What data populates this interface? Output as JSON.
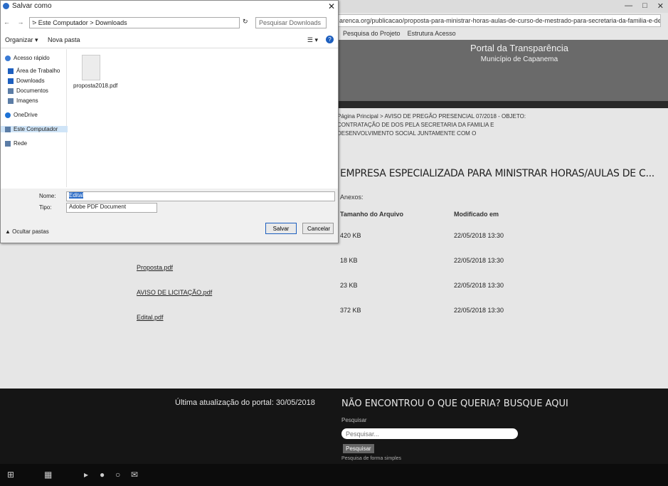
{
  "browser": {
    "controls": [
      "—",
      "□",
      "✕"
    ],
    "address": "arenca.org/publicacao/proposta-para-ministrar-horas-aulas-de-curso-de-mestrado-para-secretaria-da-familia-e-desenvolvimento-social-juntamente",
    "bookmarks": [
      "Pesquisa do Projeto",
      "Estrutura Acesso"
    ]
  },
  "site": {
    "title": "Portal da Transparência",
    "subtitle": "Município de Capanema",
    "breadcrumb": "Página Principal > AVISO DE PREGÃO PRESENCIAL 07/2018 - OBJETO: CONTRATAÇÃO DE DOS PELA SECRETARIA DA FAMILIA E DESENVOLVIMENTO SOCIAL JUNTAMENTE COM O",
    "heading": "EMPRESA ESPECIALIZADA PARA MINISTRAR HORAS/AULAS DE C...",
    "attachments_label": "Anexos:",
    "columns": {
      "size": "Tamanho do Arquivo",
      "modified": "Modificado em"
    },
    "files": [
      {
        "name": "",
        "size": "420 KB",
        "date": "22/05/2018 13:30"
      },
      {
        "name": "Proposta.pdf",
        "size": "18 KB",
        "date": "22/05/2018 13:30"
      },
      {
        "name": "AVISO DE LICITAÇÃO.pdf",
        "size": "23 KB",
        "date": "22/05/2018 13:30"
      },
      {
        "name": "Edital.pdf",
        "size": "372 KB",
        "date": "22/05/2018 13:30"
      }
    ]
  },
  "footer": {
    "updated": "Última atualização do portal: 30/05/2018",
    "search_title": "NÃO ENCONTROU O QUE QUERIA? BUSQUE AQUI",
    "search_label": "Pesquisar",
    "search_placeholder": "Pesquisar...",
    "search_button": "Pesquisar",
    "search_hint": "Pesquisa de forma simples"
  },
  "dialog": {
    "title": "Salvar como",
    "close": "✕",
    "nav_arrows": "← → ↑",
    "path": "> Este Computador > Downloads",
    "refresh": "↻",
    "search_placeholder": "Pesquisar Downloads",
    "organize": "Organizar ▾",
    "new_folder": "Nova pasta",
    "view": "☰ ▾",
    "help": "?",
    "nav": [
      {
        "label": "Acesso rápido",
        "color": "#3a7bd5"
      },
      {
        "label": "Área de Trabalho",
        "color": "#1d5fbf"
      },
      {
        "label": "Downloads",
        "color": "#1d5fbf"
      },
      {
        "label": "Documentos",
        "color": "#5c7da6"
      },
      {
        "label": "Imagens",
        "color": "#5c7da6"
      },
      {
        "label": "OneDrive",
        "color": "#1e73d6"
      },
      {
        "label": "Este Computador",
        "color": "#5c7da6"
      },
      {
        "label": "Rede",
        "color": "#5c7da6"
      }
    ],
    "file_tile": "proposta2018.pdf",
    "name_label": "Nome:",
    "name_value": "Edital",
    "type_label": "Tipo:",
    "type_value": "Adobe PDF Document",
    "hide_folders": "▲ Ocultar pastas",
    "save_button": "Salvar",
    "cancel_button": "Cancelar"
  },
  "taskbar": {
    "icons": [
      "⊞",
      "▦",
      "▸",
      "●",
      "○",
      "✉"
    ]
  }
}
